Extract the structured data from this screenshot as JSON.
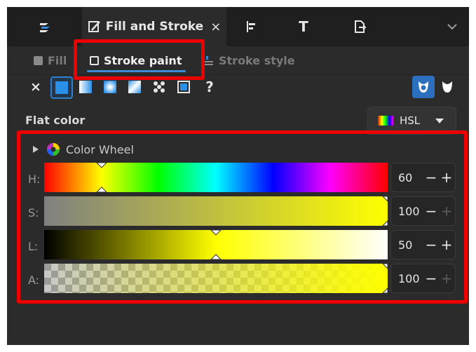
{
  "tabs": [
    {
      "icon": "layers-icon"
    },
    {
      "icon": "fill-stroke-icon",
      "label": "Fill and Stroke",
      "close": "×"
    },
    {
      "icon": "align-icon"
    },
    {
      "icon": "text-icon",
      "glyph": "T"
    },
    {
      "icon": "export-icon"
    }
  ],
  "subtabs": {
    "fill": "Fill",
    "stroke_paint": "Stroke paint",
    "stroke_style": "Stroke style"
  },
  "paint_types": {
    "none": "×",
    "unset": "?"
  },
  "section_label": "Flat color",
  "color_mode": {
    "label": "HSL"
  },
  "color_wheel_label": "Color Wheel",
  "sliders": [
    {
      "label": "H:",
      "value": "60",
      "minus": "−",
      "plus": "+"
    },
    {
      "label": "S:",
      "value": "100",
      "minus": "−",
      "plus": "+"
    },
    {
      "label": "L:",
      "value": "50",
      "minus": "−",
      "plus": "+"
    },
    {
      "label": "A:",
      "value": "100",
      "minus": "−",
      "plus": "+"
    }
  ],
  "colors": {
    "accent": "#3a8bd6",
    "current": "#ffff00",
    "highlight": "#ee0000"
  }
}
